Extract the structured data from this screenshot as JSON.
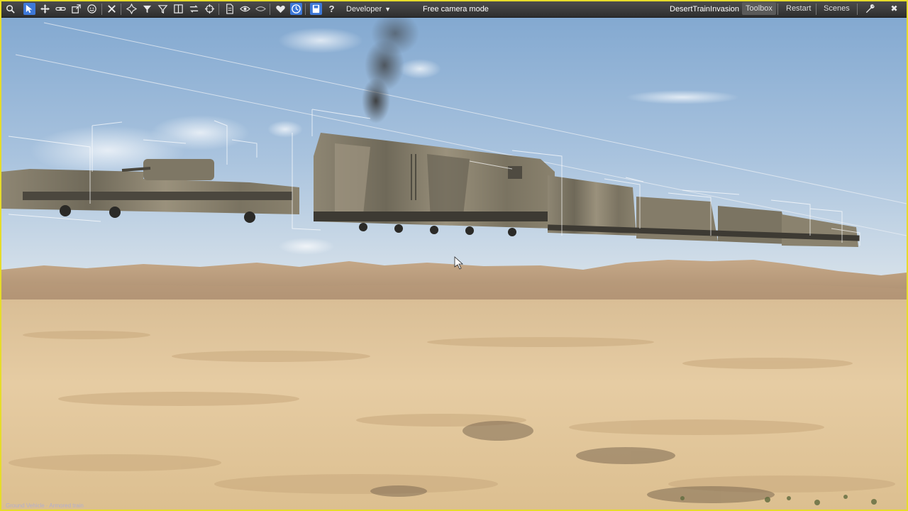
{
  "toolbar": {
    "tool_icons": [
      "search-icon",
      "select-arrow-icon",
      "move-icon",
      "link-icon",
      "scale-icon",
      "smile-icon",
      "close-cross-icon",
      "pivot-icon",
      "funnel-icon",
      "outline-funnel-icon",
      "split-view-icon",
      "swap-icon",
      "crosshair-icon",
      "document-icon",
      "eye-icon",
      "eye-outline-icon",
      "heart-icon",
      "clock-icon",
      "save-icon",
      "help-icon"
    ],
    "developer_menu": "Developer",
    "dropdown_caret": "▼",
    "mode_label": "Free camera mode",
    "scene_name": "DesertTrainInvasion",
    "toolbox_label": "Toolbox",
    "restart_label": "Restart",
    "scenes_label": "Scenes",
    "settings_icon": "wrench-icon",
    "close_icon": "close-icon",
    "close_glyph": "✖"
  },
  "colors": {
    "frame_border": "#e6dc2a",
    "toolbar_bg": "#3a3a3a",
    "active_tool": "#3d78d8",
    "sky_top": "#7fa6cf",
    "sky_horizon": "#cfdde8",
    "sand": "#e2c79a",
    "train_camo": "#8a8270"
  },
  "viewport": {
    "label": "3D viewport",
    "cursor_icon": "mouse-pointer-icon"
  },
  "status_line": "Ground Vehicle · Armored train"
}
